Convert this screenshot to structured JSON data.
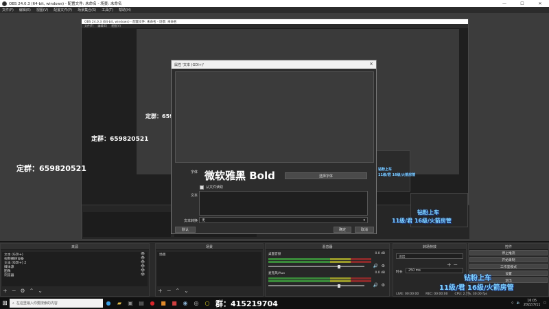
{
  "window": {
    "title": "OBS 24.0.3 (64-bit, windows) - 配置文件: 未命名 - 场景: 未命名",
    "controls": [
      "—",
      "☐",
      "✕"
    ]
  },
  "menu": [
    "文件(F)",
    "编辑(E)",
    "视图(V)",
    "配置文件(P)",
    "场景集合(S)",
    "工具(T)",
    "帮助(H)"
  ],
  "nested": {
    "title": "OBS 24.0.3 (64-bit, windows) - 配置文件: 未命名 - 场景: 未命名"
  },
  "overlays": {
    "group_large": "定群：659820521",
    "group_medium": "定群：659820521",
    "group_small": "定群：659820521",
    "bottom_group": "群：415219704",
    "promo_line1": "钻粉上车",
    "promo_line2": "11级/君 16级/火箭房管",
    "promo_line1_small": "钻粉上车",
    "promo_line2_small": "11级/君 16级/火箭房管"
  },
  "dialog": {
    "title": "属性 '文本 (GDI+)'",
    "font_label": "字体",
    "font_sample": "微软雅黑 Bold",
    "select_font_button": "选择字体",
    "read_from_file_label": "从文件读取",
    "text_label": "文本",
    "transform_label": "文本转换",
    "transform_value": "无",
    "defaults_button": "默认",
    "ok_button": "确定",
    "cancel_button": "取消"
  },
  "docks": {
    "scenes": {
      "header": "来源",
      "items": [
        "文本 (GDI+)",
        "视频捕获设备",
        "文本 (GDI+) 2",
        "媒体源",
        "图像",
        "浏览器"
      ]
    },
    "sources": {
      "header": "场景",
      "items": [
        "场景"
      ]
    },
    "mixer": {
      "header": "混音器",
      "channels": [
        {
          "name": "桌面音频",
          "db": "0.0 dB",
          "level": 0.72
        },
        {
          "name": "麦克风/Aux",
          "db": "0.0 dB",
          "level": 0.72
        }
      ]
    },
    "transitions": {
      "header": "转场特效",
      "type": "淡出",
      "duration_label": "时长",
      "duration_value": "250 ms"
    },
    "controls": {
      "header": "控件",
      "buttons": [
        "停止推流",
        "开始录制",
        "工作室模式",
        "设置",
        "退出"
      ]
    }
  },
  "status": {
    "live": "LIVE: 00:00:00",
    "rec": "REC: 00:00:00",
    "cpu": "CPU: 2.7%, 30.00 fps"
  },
  "taskbar": {
    "search_placeholder": "在这里输入你要搜索的内容",
    "time": "16:05",
    "date": "2022/7/11"
  },
  "colors": {
    "promo_text": "#7fd3ff",
    "promo_outline": "#1a3a8a",
    "accent_red": "#d9252a"
  }
}
